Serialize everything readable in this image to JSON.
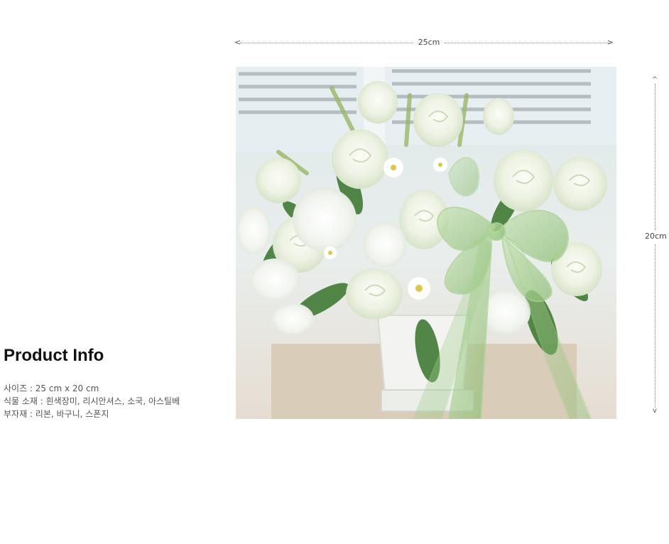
{
  "dimensions": {
    "width_label": "25cm",
    "height_label": "20cm",
    "arrow_left": "<",
    "arrow_right": ">",
    "arrow_up": "^",
    "arrow_down": "v"
  },
  "product_photo": {
    "subject": "white roses and lisianthus arrangement in white basket with green ribbon bow"
  },
  "product_info": {
    "title": "Product Info",
    "lines": [
      "사이즈 : 25 cm x 20 cm",
      "식물 소재 : 흰색장미, 리시안셔스, 소국, 아스틸베",
      "부자재 : 리본, 바구니, 스폰지"
    ]
  },
  "colors": {
    "background": "#ffffff",
    "title_text": "#111111",
    "body_text": "#555555",
    "ribbon_green": "#8fc27a",
    "rose_white": "#f4f6ef"
  }
}
